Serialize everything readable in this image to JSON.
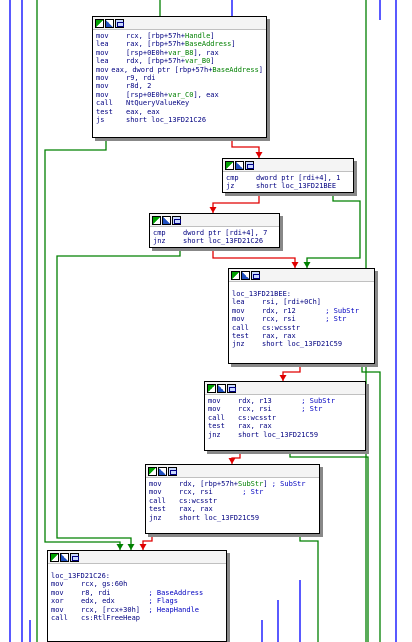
{
  "colors": {
    "true_branch": "#008000",
    "false_branch": "#e00000",
    "unconditional": "#0000ff",
    "mnemonic": "#000080",
    "symbol": "#008000",
    "comment": "#0000c0"
  },
  "blocks": [
    {
      "lines": [
        {
          "m": "mov",
          "ops": [
            [
              "rcx, [rbp+57h+",
              ""
            ],
            [
              "Handle",
              "sym"
            ],
            [
              "]",
              ""
            ]
          ]
        },
        {
          "m": "lea",
          "ops": [
            [
              "rax, [rbp+57h+",
              ""
            ],
            [
              "BaseAddress",
              "sym"
            ],
            [
              "]",
              ""
            ]
          ]
        },
        {
          "m": "mov",
          "ops": [
            [
              "[rsp+0E0h+",
              ""
            ],
            [
              "var_B8",
              "sym"
            ],
            [
              "], rax",
              ""
            ]
          ]
        },
        {
          "m": "lea",
          "ops": [
            [
              "rdx, [rbp+57h+",
              ""
            ],
            [
              "var_B0",
              "sym"
            ],
            [
              "]",
              ""
            ]
          ]
        },
        {
          "m": "mov",
          "ops": [
            [
              "eax, dword ptr [rbp+57h+",
              ""
            ],
            [
              "BaseAddress",
              "sym"
            ],
            [
              "]",
              ""
            ]
          ]
        },
        {
          "m": "mov",
          "ops": [
            [
              "r9, rdi",
              ""
            ]
          ]
        },
        {
          "m": "mov",
          "ops": [
            [
              "r8d, 2",
              ""
            ]
          ]
        },
        {
          "m": "mov",
          "ops": [
            [
              "[rsp+0E0h+",
              ""
            ],
            [
              "var_C0",
              "sym"
            ],
            [
              "], eax",
              ""
            ]
          ]
        },
        {
          "m": "call",
          "ops": [
            [
              "NtQueryValueKey",
              ""
            ]
          ]
        },
        {
          "m": "test",
          "ops": [
            [
              "eax, eax",
              ""
            ]
          ]
        },
        {
          "m": "js",
          "ops": [
            [
              "short loc_13FD21C26",
              ""
            ]
          ]
        }
      ]
    },
    {
      "lines": [
        {
          "m": "cmp",
          "ops": [
            [
              "dword ptr [rdi+4], 1",
              ""
            ]
          ]
        },
        {
          "m": "jz",
          "ops": [
            [
              "short loc_13FD21BEE",
              ""
            ]
          ]
        }
      ]
    },
    {
      "lines": [
        {
          "m": "cmp",
          "ops": [
            [
              "dword ptr [rdi+4], 7",
              ""
            ]
          ]
        },
        {
          "m": "jnz",
          "ops": [
            [
              "short loc_13FD21C26",
              ""
            ]
          ]
        }
      ]
    },
    {
      "label": "loc_13FD21BEE:",
      "lines": [
        {
          "m": "lea",
          "ops": [
            [
              "rsi, [rdi+0Ch]",
              ""
            ]
          ]
        },
        {
          "m": "mov",
          "ops": [
            [
              "rdx, r12       ",
              ""
            ],
            [
              "; SubStr",
              "cmt"
            ]
          ]
        },
        {
          "m": "mov",
          "ops": [
            [
              "rcx, rsi       ",
              ""
            ],
            [
              "; Str",
              "cmt"
            ]
          ]
        },
        {
          "m": "call",
          "ops": [
            [
              "cs:wcsstr",
              ""
            ]
          ]
        },
        {
          "m": "test",
          "ops": [
            [
              "rax, rax",
              ""
            ]
          ]
        },
        {
          "m": "jnz",
          "ops": [
            [
              "short loc_13FD21C59",
              ""
            ]
          ]
        }
      ]
    },
    {
      "lines": [
        {
          "m": "mov",
          "ops": [
            [
              "rdx, r13       ",
              ""
            ],
            [
              "; SubStr",
              "cmt"
            ]
          ]
        },
        {
          "m": "mov",
          "ops": [
            [
              "rcx, rsi       ",
              ""
            ],
            [
              "; Str",
              "cmt"
            ]
          ]
        },
        {
          "m": "call",
          "ops": [
            [
              "cs:wcsstr",
              ""
            ]
          ]
        },
        {
          "m": "test",
          "ops": [
            [
              "rax, rax",
              ""
            ]
          ]
        },
        {
          "m": "jnz",
          "ops": [
            [
              "short loc_13FD21C59",
              ""
            ]
          ]
        }
      ]
    },
    {
      "lines": [
        {
          "m": "mov",
          "ops": [
            [
              "rdx, [rbp+57h+",
              ""
            ],
            [
              "SubStr",
              "sym"
            ],
            [
              "] ",
              ""
            ],
            [
              "; SubStr",
              "cmt"
            ]
          ]
        },
        {
          "m": "mov",
          "ops": [
            [
              "rcx, rsi       ",
              ""
            ],
            [
              "; Str",
              "cmt"
            ]
          ]
        },
        {
          "m": "call",
          "ops": [
            [
              "cs:wcsstr",
              ""
            ]
          ]
        },
        {
          "m": "test",
          "ops": [
            [
              "rax, rax",
              ""
            ]
          ]
        },
        {
          "m": "jnz",
          "ops": [
            [
              "short loc_13FD21C59",
              ""
            ]
          ]
        }
      ]
    },
    {
      "label": "loc_13FD21C26:",
      "lines": [
        {
          "m": "mov",
          "ops": [
            [
              "rcx, gs:60h",
              ""
            ]
          ]
        },
        {
          "m": "mov",
          "ops": [
            [
              "r8, rdi         ",
              ""
            ],
            [
              "; BaseAddress",
              "cmt"
            ]
          ]
        },
        {
          "m": "xor",
          "ops": [
            [
              "edx, edx        ",
              ""
            ],
            [
              "; Flags",
              "cmt"
            ]
          ]
        },
        {
          "m": "mov",
          "ops": [
            [
              "rcx, [rcx+30h]  ",
              ""
            ],
            [
              "; HeapHandle",
              "cmt"
            ]
          ]
        },
        {
          "m": "call",
          "ops": [
            [
              "cs:RtlFreeHeap",
              ""
            ]
          ]
        }
      ]
    }
  ]
}
